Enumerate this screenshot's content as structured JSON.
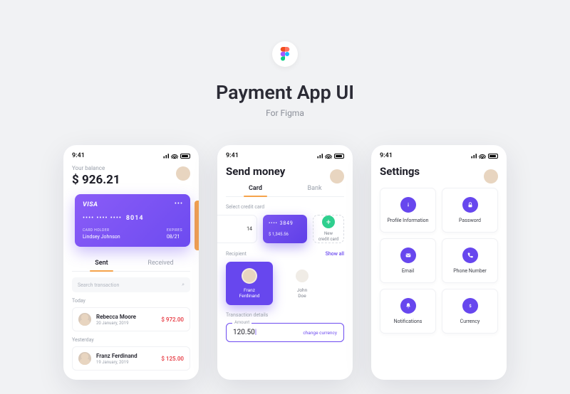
{
  "hero": {
    "title": "Payment App UI",
    "subtitle": "For Figma"
  },
  "status_time": "9:41",
  "p1": {
    "balance_label": "Your balance",
    "balance": "$ 926.21",
    "card": {
      "brand": "VISA",
      "masked": "•••• •••• ••••",
      "last4": "8014",
      "holder_label": "CARD HOLDER",
      "holder": "Lindsey Johnson",
      "exp_label": "EXPIRES",
      "exp": "08/21"
    },
    "tabs": {
      "sent": "Sent",
      "received": "Received"
    },
    "search_placeholder": "Search transaction",
    "groups": [
      {
        "label": "Today",
        "items": [
          {
            "name": "Rebecca Moore",
            "date": "20 January, 2019",
            "amount": "$ 972.00"
          }
        ]
      },
      {
        "label": "Yesterday",
        "items": [
          {
            "name": "Franz Ferdinand",
            "date": "19 January, 2019",
            "amount": "$ 125.00"
          }
        ]
      }
    ]
  },
  "p2": {
    "title": "Send money",
    "tabs": {
      "card": "Card",
      "bank": "Bank"
    },
    "select_label": "Select credit card",
    "ghost_last": "14",
    "mini": {
      "masked": "••••",
      "last4": "3849",
      "balance": "$ 1,345.56"
    },
    "new_card": "New\ncredit card",
    "recipient_label": "Recipient",
    "show_all": "Show all",
    "recipients": [
      {
        "name": "Franz\nFerdinand"
      },
      {
        "name": "John\nDoe"
      }
    ],
    "tx_label": "Transaction details",
    "amount_label": "Amount",
    "amount": "120.50",
    "change_currency": "change currency"
  },
  "p3": {
    "title": "Settings",
    "tiles": [
      {
        "icon": "info",
        "label": "Profile Information"
      },
      {
        "icon": "lock",
        "label": "Password"
      },
      {
        "icon": "mail",
        "label": "Email"
      },
      {
        "icon": "phone",
        "label": "Phone Number"
      },
      {
        "icon": "bell",
        "label": "Notifications"
      },
      {
        "icon": "dollar",
        "label": "Currency"
      }
    ]
  }
}
